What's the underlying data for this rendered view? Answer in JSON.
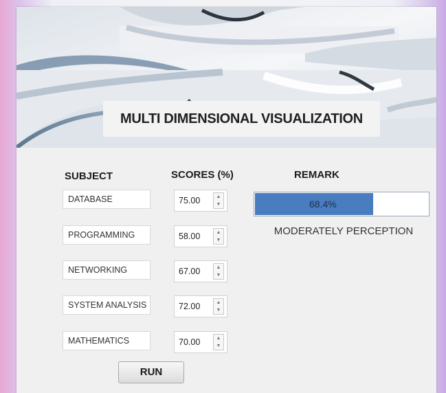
{
  "banner": {
    "title": "MULTI DIMENSIONAL VISUALIZATION"
  },
  "headers": {
    "subject": "SUBJECT",
    "scores": "SCORES (%)",
    "remark": "REMARK"
  },
  "subjects": [
    {
      "name": "DATABASE",
      "score": "75.00"
    },
    {
      "name": "PROGRAMMING",
      "score": "58.00"
    },
    {
      "name": "NETWORKING",
      "score": "67.00"
    },
    {
      "name": "SYSTEM ANALYSIS",
      "score": "72.00"
    },
    {
      "name": "MATHEMATICS",
      "score": "70.00"
    }
  ],
  "result": {
    "progress_text": "68.4%",
    "progress_value": 0.684,
    "remark_text": "MODERATELY PERCEPTION"
  },
  "run_button": {
    "label": "RUN"
  },
  "colors": {
    "progress_fill": "#4a7cc0",
    "window_background": "#f0f0f0"
  }
}
